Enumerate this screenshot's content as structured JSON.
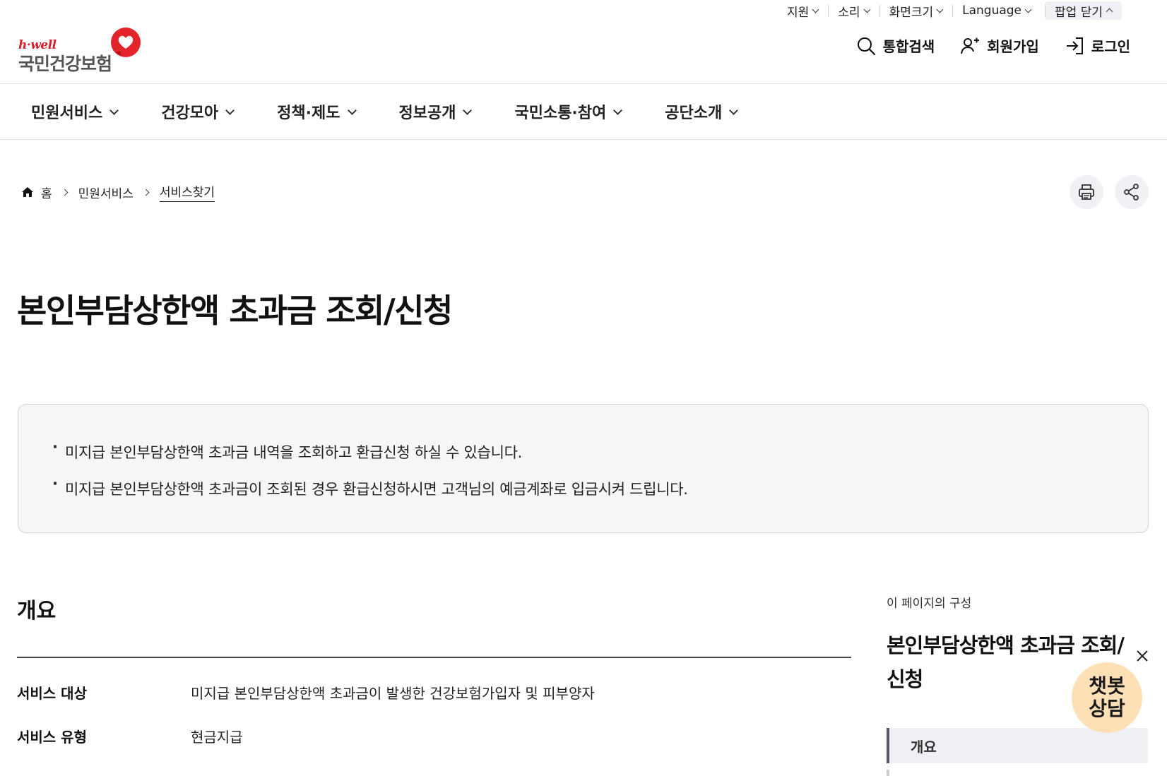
{
  "utility": {
    "support": "지원",
    "sound": "소리",
    "screen_size": "화면크기",
    "language": "Language",
    "popup_close": "팝업 닫기"
  },
  "logo": {
    "brand_en": "h·well",
    "brand_kr": "국민건강보험"
  },
  "header_actions": {
    "search": "통합검색",
    "signup": "회원가입",
    "login": "로그인"
  },
  "gnb": [
    {
      "label": "민원서비스"
    },
    {
      "label": "건강모아"
    },
    {
      "label": "정책·제도"
    },
    {
      "label": "정보공개"
    },
    {
      "label": "국민소통·참여"
    },
    {
      "label": "공단소개"
    }
  ],
  "breadcrumb": {
    "home": "홈",
    "level1": "민원서비스",
    "current": "서비스찾기"
  },
  "page_title": "본인부담상한액 초과금 조회/신청",
  "info": [
    "미지급 본인부담상한액 초과금 내역을 조회하고 환급신청 하실 수 있습니다.",
    "미지급 본인부담상한액 초과금이 조회된 경우 환급신청하시면 고객님의 예금계좌로 입금시켜 드립니다."
  ],
  "overview": {
    "title": "개요",
    "rows": [
      {
        "key": "서비스 대상",
        "value": "미지급 본인부담상한액 초과금이 발생한 건강보험가입자 및 피부양자"
      },
      {
        "key": "서비스 유형",
        "value": "현금지급"
      }
    ]
  },
  "toc": {
    "caption": "이 페이지의 구성",
    "title": "본인부담상한액 초과금 조회/신청",
    "items": [
      {
        "label": "개요"
      }
    ]
  },
  "chatbot": {
    "label_line1": "챗봇",
    "label_line2": "상담"
  },
  "colors": {
    "brand_red": "#d71e2b",
    "chatbot_bg": "#fde0b6",
    "toc_active_bar": "#555a66"
  }
}
